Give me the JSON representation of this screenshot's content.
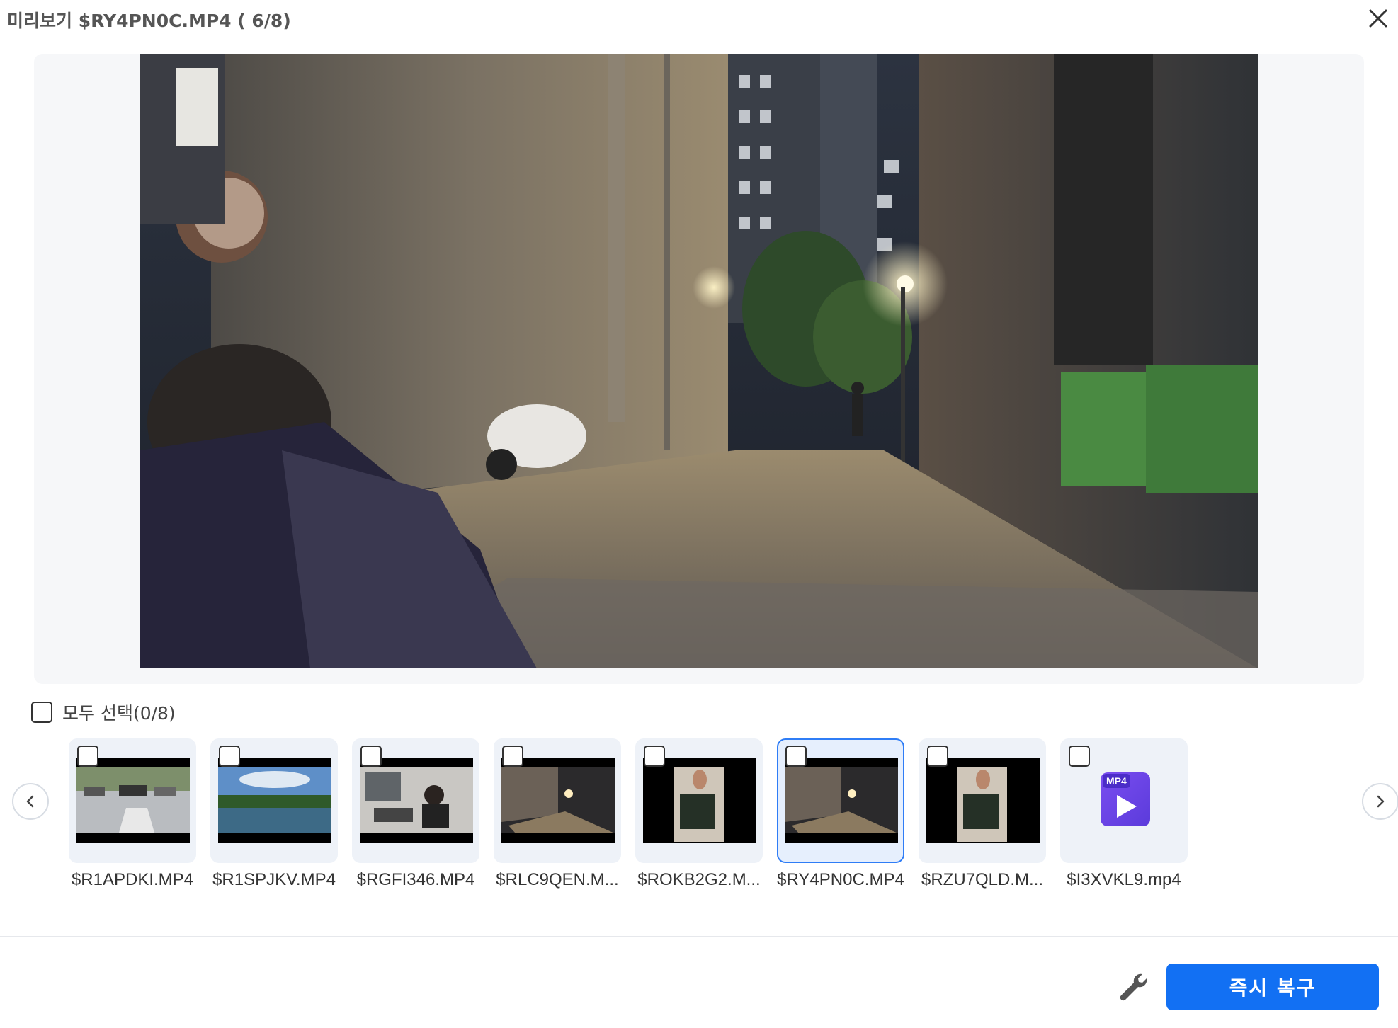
{
  "dialog": {
    "title": "미리보기 $RY4PN0C.MP4 ( 6/8)"
  },
  "select_all": {
    "label": "모두 선택(0/8)"
  },
  "thumbnails": [
    {
      "name": "$R1APDKI.MP4",
      "scene": "parking-lot"
    },
    {
      "name": "$R1SPJKV.MP4",
      "scene": "lake"
    },
    {
      "name": "$RGFI346.MP4",
      "scene": "office"
    },
    {
      "name": "$RLC9QEN.M...",
      "scene": "night-street"
    },
    {
      "name": "$ROKB2G2.M...",
      "scene": "hand-card"
    },
    {
      "name": "$RY4PN0C.MP4",
      "scene": "night-street",
      "selected": true
    },
    {
      "name": "$RZU7QLD.M...",
      "scene": "hand-card"
    },
    {
      "name": "$I3XVKL9.mp4",
      "scene": "mp4-icon",
      "icon_label": "MP4"
    }
  ],
  "footer": {
    "recover_label": "즉시 복구"
  },
  "colors": {
    "accent": "#1270f3",
    "selected_border": "#2f7df6",
    "thumb_bg": "#eef2f8"
  }
}
